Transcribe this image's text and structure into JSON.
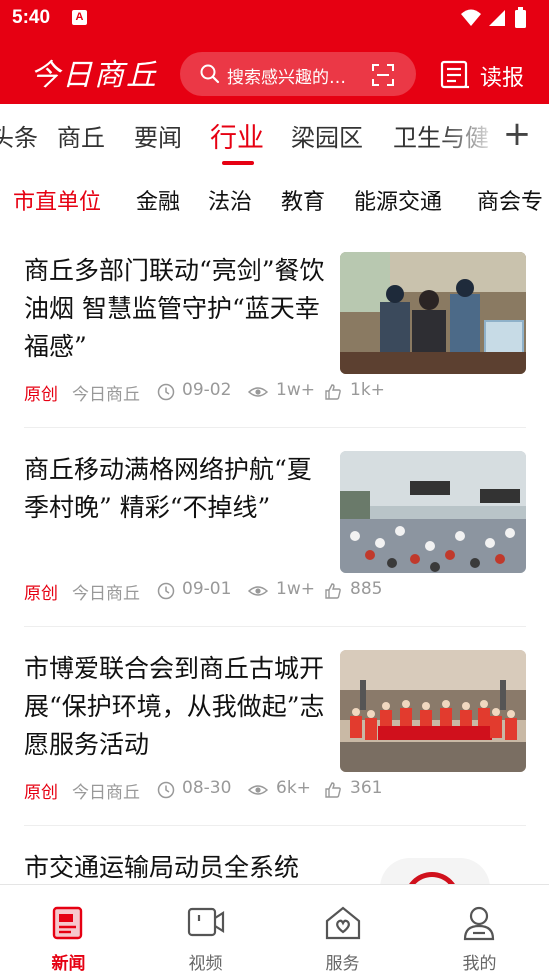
{
  "status_bar": {
    "time": "5:40",
    "notification_badge": "A"
  },
  "header": {
    "logo_text": "今日商丘",
    "search_placeholder": "搜索感兴趣的…",
    "read_label": "读报"
  },
  "tabs": {
    "items": [
      "头条",
      "商丘",
      "要闻",
      "行业",
      "梁园区",
      "卫生与健"
    ],
    "active": "行业",
    "add_symbol": "+"
  },
  "subtabs": {
    "items": [
      "市直单位",
      "金融",
      "法治",
      "教育",
      "能源交通",
      "商会专"
    ],
    "active": "市直单位"
  },
  "news": [
    {
      "title": "商丘多部门联动“亮剑”餐饮油烟 智慧监管守护“蓝天幸福感”",
      "tag": "原创",
      "source": "今日商丘",
      "date": "09-02",
      "views": "1w+",
      "likes": "1k+",
      "thumb": "inspection-photo"
    },
    {
      "title": "商丘移动满格网络护航“夏季村晚” 精彩“不掉线”",
      "tag": "原创",
      "source": "今日商丘",
      "date": "09-01",
      "views": "1w+",
      "likes": "885",
      "thumb": "evening-show-photo"
    },
    {
      "title": "市博爱联合会到商丘古城开展“保护环境，从我做起”志愿服务活动",
      "tag": "原创",
      "source": "今日商丘",
      "date": "08-30",
      "views": "6k+",
      "likes": "361",
      "thumb": "volunteer-group-photo"
    },
    {
      "title": "市交通运输局动员全系统",
      "tag": "",
      "source": "",
      "date": "",
      "views": "",
      "likes": "",
      "thumb": ""
    }
  ],
  "bottom_nav": {
    "items": [
      {
        "label": "新闻",
        "icon": "news-icon"
      },
      {
        "label": "视频",
        "icon": "video-icon"
      },
      {
        "label": "服务",
        "icon": "service-icon"
      },
      {
        "label": "我的",
        "icon": "profile-icon"
      }
    ],
    "active": "新闻"
  },
  "colors": {
    "brand_red": "#e60012",
    "meta_gray": "#999999",
    "text_dark": "#111111"
  }
}
